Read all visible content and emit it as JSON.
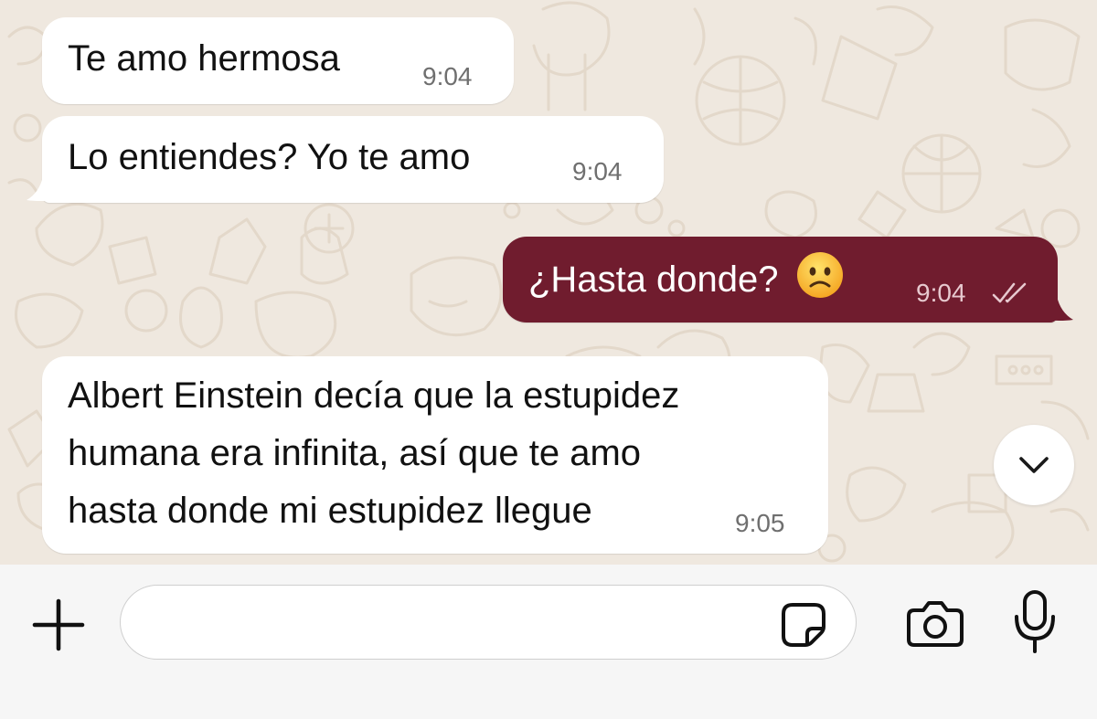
{
  "chat": {
    "messages": [
      {
        "direction": "incoming",
        "text": "Te amo hermosa",
        "time": "9:04"
      },
      {
        "direction": "incoming",
        "text": "Lo entiendes? Yo te amo",
        "time": "9:04"
      },
      {
        "direction": "outgoing",
        "text": "¿Hasta donde?",
        "emoji": "frowning-face",
        "time": "9:04",
        "status": "delivered-double-check"
      },
      {
        "direction": "incoming",
        "lines": [
          "Albert Einstein decía que la estupidez",
          "humana era infinita, así que te amo",
          "hasta donde mi estupidez llegue"
        ],
        "time": "9:05"
      }
    ],
    "scroll_down_icon": "chevron-down-icon"
  },
  "composer": {
    "input_value": "",
    "input_placeholder": "",
    "icons": [
      "plus-icon",
      "sticker-icon",
      "camera-icon",
      "microphone-icon"
    ]
  },
  "colors": {
    "outgoing_bubble": "#701c2e",
    "incoming_bubble": "#ffffff",
    "wallpaper": "#efe8df",
    "composer_bar": "#f6f6f6"
  }
}
